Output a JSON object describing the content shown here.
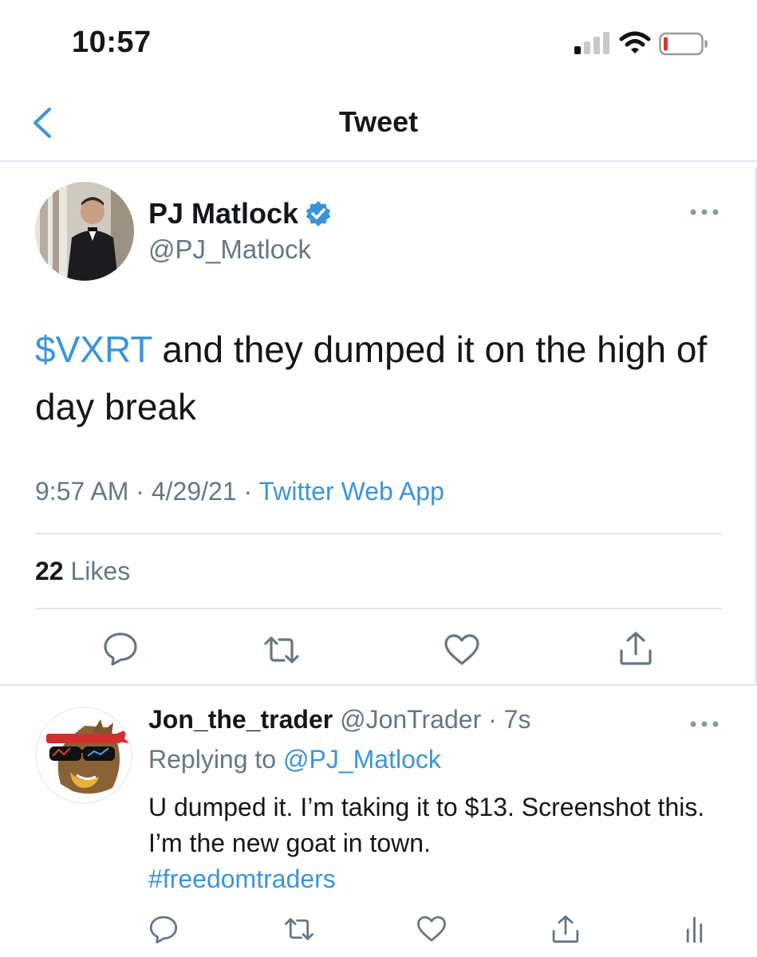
{
  "status_bar": {
    "time": "10:57"
  },
  "nav": {
    "title": "Tweet"
  },
  "tweet": {
    "author_name": "PJ Matlock",
    "author_handle": "@PJ_Matlock",
    "cashtag": "$VXRT",
    "text_rest": " and they dumped it on the high of day break",
    "time": "9:57 AM",
    "separator": " · ",
    "date": "4/29/21",
    "source": "Twitter Web App",
    "likes_count": "22",
    "likes_label": "Likes"
  },
  "reply": {
    "author_name": "Jon_the_trader",
    "author_handle": "@JonTrader",
    "age": "7s",
    "replying_prefix": "Replying to ",
    "replying_to": "@PJ_Matlock",
    "text": "U dumped it. I’m taking it to $13. Screenshot this. I’m the new goat in town.",
    "hashtag": "#freedomtraders"
  },
  "colors": {
    "accent": "#3b94d9",
    "text": "#14171a",
    "muted": "#657786",
    "divider": "#e1e8ed",
    "battery_low": "#e0312c"
  },
  "icons": {
    "back": "chevron-left-icon",
    "verified": "verified-badge-icon",
    "more": "more-horizontal-icon",
    "reply": "comment-icon",
    "retweet": "retweet-icon",
    "like": "heart-icon",
    "share": "share-icon",
    "analytics": "analytics-icon"
  }
}
